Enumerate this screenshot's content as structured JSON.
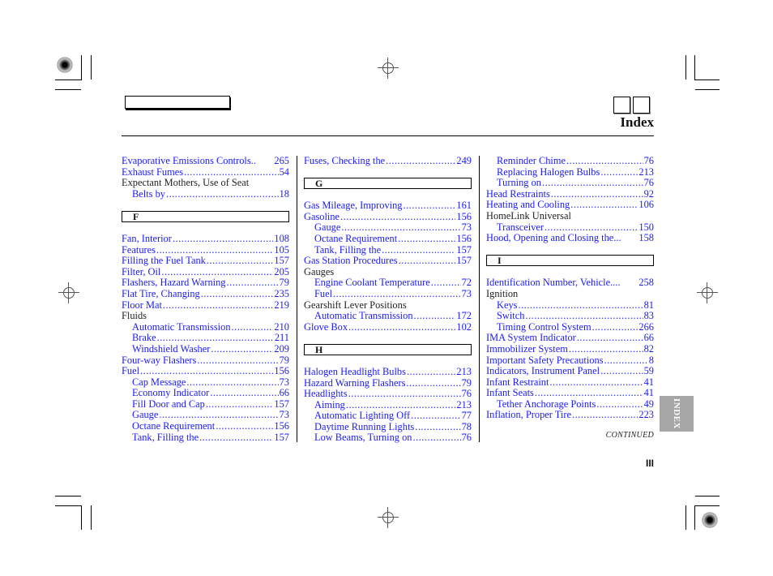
{
  "header": {
    "title": "Index"
  },
  "columns": [
    {
      "entries": [
        {
          "type": "link",
          "text": "Evaporative Emissions Controls..",
          "page": "265",
          "indent": false,
          "nodots": true
        },
        {
          "type": "link",
          "text": "Exhaust Fumes",
          "page": "54",
          "indent": false
        },
        {
          "type": "plain",
          "text": "Expectant Mothers, Use of Seat",
          "indent": false
        },
        {
          "type": "link",
          "text": "Belts by",
          "page": "18",
          "indent": true
        },
        {
          "type": "gap"
        },
        {
          "type": "letter",
          "text": "F"
        },
        {
          "type": "link",
          "text": "Fan, Interior",
          "page": "108",
          "indent": false
        },
        {
          "type": "link",
          "text": "Features",
          "page": "105",
          "indent": false
        },
        {
          "type": "link",
          "text": "Filling the Fuel Tank",
          "page": "157",
          "indent": false
        },
        {
          "type": "link",
          "text": "Filter, Oil",
          "page": "205",
          "indent": false
        },
        {
          "type": "link",
          "text": "Flashers, Hazard Warning",
          "page": "79",
          "indent": false
        },
        {
          "type": "link",
          "text": "Flat Tire, Changing",
          "page": "235",
          "indent": false
        },
        {
          "type": "link",
          "text": "Floor Mat",
          "page": "219",
          "indent": false
        },
        {
          "type": "plain",
          "text": "Fluids",
          "indent": false
        },
        {
          "type": "link",
          "text": "Automatic Transmission",
          "page": "210",
          "indent": true
        },
        {
          "type": "link",
          "text": "Brake",
          "page": "211",
          "indent": true
        },
        {
          "type": "link",
          "text": "Windshield Washer",
          "page": "209",
          "indent": true
        },
        {
          "type": "link",
          "text": "Four-way Flashers",
          "page": "79",
          "indent": false
        },
        {
          "type": "link",
          "text": "Fuel",
          "page": "156",
          "indent": false
        },
        {
          "type": "link",
          "text": "Cap Message",
          "page": "73",
          "indent": true
        },
        {
          "type": "link",
          "text": "Economy Indicator",
          "page": "66",
          "indent": true
        },
        {
          "type": "link",
          "text": "Fill Door and Cap",
          "page": "157",
          "indent": true
        },
        {
          "type": "link",
          "text": "Gauge",
          "page": "73",
          "indent": true
        },
        {
          "type": "link",
          "text": "Octane Requirement",
          "page": "156",
          "indent": true
        },
        {
          "type": "link",
          "text": "Tank, Filling the",
          "page": "157",
          "indent": true
        }
      ]
    },
    {
      "entries": [
        {
          "type": "link",
          "text": "Fuses, Checking the",
          "page": "249",
          "indent": false
        },
        {
          "type": "gap"
        },
        {
          "type": "letter",
          "text": "G"
        },
        {
          "type": "link",
          "text": "Gas Mileage, Improving",
          "page": "161",
          "indent": false
        },
        {
          "type": "link",
          "text": "Gasoline",
          "page": "156",
          "indent": false
        },
        {
          "type": "link",
          "text": "Gauge",
          "page": "73",
          "indent": true
        },
        {
          "type": "link",
          "text": "Octane Requirement",
          "page": "156",
          "indent": true
        },
        {
          "type": "link",
          "text": "Tank, Filling the",
          "page": "157",
          "indent": true
        },
        {
          "type": "link",
          "text": "Gas Station Procedures",
          "page": "157",
          "indent": false
        },
        {
          "type": "plain",
          "text": "Gauges",
          "indent": false
        },
        {
          "type": "link",
          "text": "Engine Coolant Temperature",
          "page": "72",
          "indent": true
        },
        {
          "type": "link",
          "text": "Fuel",
          "page": "73",
          "indent": true
        },
        {
          "type": "plain",
          "text": "Gearshift Lever Positions",
          "indent": false
        },
        {
          "type": "link",
          "text": "Automatic Transmission",
          "page": "172",
          "indent": true
        },
        {
          "type": "link",
          "text": "Glove Box",
          "page": "102",
          "indent": false
        },
        {
          "type": "gap"
        },
        {
          "type": "letter",
          "text": "H"
        },
        {
          "type": "link",
          "text": "Halogen Headlight Bulbs",
          "page": "213",
          "indent": false
        },
        {
          "type": "link",
          "text": "Hazard Warning Flashers",
          "page": "79",
          "indent": false
        },
        {
          "type": "link",
          "text": "Headlights",
          "page": "76",
          "indent": false
        },
        {
          "type": "link",
          "text": "Aiming",
          "page": "213",
          "indent": true
        },
        {
          "type": "link",
          "text": "Automatic Lighting Off",
          "page": "77",
          "indent": true
        },
        {
          "type": "link",
          "text": "Daytime Running Lights",
          "page": "78",
          "indent": true
        },
        {
          "type": "link",
          "text": "Low Beams, Turning on",
          "page": "76",
          "indent": true
        }
      ]
    },
    {
      "entries": [
        {
          "type": "link",
          "text": "Reminder Chime",
          "page": "76",
          "indent": true
        },
        {
          "type": "link",
          "text": "Replacing Halogen Bulbs",
          "page": "213",
          "indent": true
        },
        {
          "type": "link",
          "text": "Turning on",
          "page": "76",
          "indent": true
        },
        {
          "type": "link",
          "text": "Head Restraints",
          "page": "92",
          "indent": false
        },
        {
          "type": "link",
          "text": "Heating and Cooling",
          "page": "106",
          "indent": false
        },
        {
          "type": "plain",
          "text": "HomeLink Universal",
          "indent": false
        },
        {
          "type": "link",
          "text": "Transceiver",
          "page": "150",
          "indent": true
        },
        {
          "type": "link",
          "text": "Hood, Opening and Closing the...",
          "page": "158",
          "indent": false,
          "nodots": true
        },
        {
          "type": "gap"
        },
        {
          "type": "letter",
          "text": "I"
        },
        {
          "type": "link",
          "text": "Identification Number, Vehicle....",
          "page": "258",
          "indent": false,
          "nodots": true
        },
        {
          "type": "plain",
          "text": "Ignition",
          "indent": false
        },
        {
          "type": "link",
          "text": "Keys",
          "page": "81",
          "indent": true
        },
        {
          "type": "link",
          "text": "Switch",
          "page": "83",
          "indent": true
        },
        {
          "type": "link",
          "text": "Timing Control System",
          "page": "266",
          "indent": true
        },
        {
          "type": "link",
          "text": "IMA System Indicator",
          "page": "66",
          "indent": false
        },
        {
          "type": "link",
          "text": "Immobilizer System",
          "page": "82",
          "indent": false
        },
        {
          "type": "link",
          "text": "Important Safety Precautions",
          "page": "8",
          "indent": false
        },
        {
          "type": "link",
          "text": "Indicators, Instrument Panel",
          "page": "59",
          "indent": false
        },
        {
          "type": "link",
          "text": "Infant Restraint",
          "page": "41",
          "indent": false
        },
        {
          "type": "link",
          "text": "Infant Seats",
          "page": "41",
          "indent": false
        },
        {
          "type": "link",
          "text": "Tether Anchorage Points",
          "page": "49",
          "indent": true
        },
        {
          "type": "link",
          "text": "Inflation, Proper Tire",
          "page": "223",
          "indent": false
        }
      ]
    }
  ],
  "side_tab": {
    "label": "INDEX",
    "color": "#a6a6a6"
  },
  "footer": {
    "continued": "CONTINUED",
    "page_number": "III"
  },
  "colors": {
    "link": "#1a1aff",
    "text": "#222222"
  }
}
